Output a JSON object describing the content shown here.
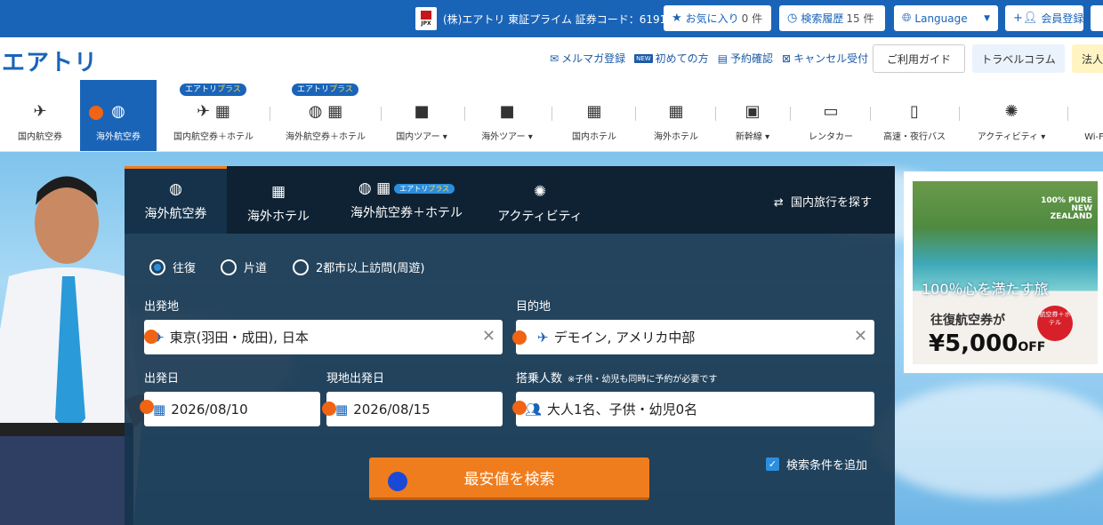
{
  "topbar": {
    "jpx_text": "JPX",
    "corp_info": "(株)エアトリ 東証プライム 証券コード：6191",
    "separator": "|",
    "favorites_label": "お気に入り",
    "favorites_count": "0 件",
    "history_label": "検索履歴",
    "history_count": "15 件",
    "language_label": "Language",
    "register_label": "会員登録"
  },
  "header": {
    "logo": "エアトリ",
    "links": [
      {
        "icon": "mail-icon",
        "label": "メルマガ登録"
      },
      {
        "icon": "new-icon",
        "label": "初めての方",
        "badge": "NEW"
      },
      {
        "icon": "document-icon",
        "label": "予約確認"
      },
      {
        "icon": "calendar-cancel-icon",
        "label": "キャンセル受付"
      }
    ],
    "guide_label": "ご利用ガイド",
    "column_label": "トラベルコラム",
    "corporate_label": "法人"
  },
  "categories": [
    {
      "label": "国内航空券",
      "active": false
    },
    {
      "label": "海外航空券",
      "active": true
    },
    {
      "label": "国内航空券＋ホテル",
      "active": false,
      "plus": true
    },
    {
      "label": "海外航空券＋ホテル",
      "active": false,
      "plus": true
    },
    {
      "label": "国内ツアー ▾",
      "active": false
    },
    {
      "label": "海外ツアー ▾",
      "active": false
    },
    {
      "label": "国内ホテル",
      "active": false
    },
    {
      "label": "海外ホテル",
      "active": false
    },
    {
      "label": "新幹線 ▾",
      "active": false
    },
    {
      "label": "レンタカー",
      "active": false
    },
    {
      "label": "高速・夜行バス",
      "active": false
    },
    {
      "label": "アクティビティ ▾",
      "active": false
    },
    {
      "label": "Wi-Fi",
      "active": false
    }
  ],
  "plus_badge": {
    "left": "エアトリ",
    "right": "プラス"
  },
  "search": {
    "tabs": [
      {
        "label": "海外航空券",
        "active": true
      },
      {
        "label": "海外ホテル",
        "active": false
      },
      {
        "label": "海外航空券＋ホテル",
        "active": false
      },
      {
        "label": "アクティビティ",
        "active": false
      }
    ],
    "switch_label": "国内旅行を探す",
    "trip_types": [
      {
        "label": "往復",
        "selected": true
      },
      {
        "label": "片道",
        "selected": false
      },
      {
        "label": "2都市以上訪問(周遊)",
        "selected": false
      }
    ],
    "origin_label": "出発地",
    "origin_value": "東京(羽田・成田), 日本",
    "destination_label": "目的地",
    "destination_value": "デモイン, アメリカ中部",
    "depart_label": "出発日",
    "depart_value": "2026/08/10",
    "return_label": "現地出発日",
    "return_value": "2026/08/15",
    "passengers_label": "搭乗人数",
    "passengers_note": "※子供・幼児も同時に予約が必要です",
    "passengers_value": "大人1名、子供・幼児0名",
    "search_button": "最安値を検索",
    "add_conditions": "検索条件を追加"
  },
  "ad": {
    "tag": "100% PURE NEW ZEALAND",
    "catch": "100％心を満たす旅",
    "round_trip": "往復航空券が",
    "seal": "航空券＋ホテル",
    "price": "¥5,000",
    "off": "OFF"
  },
  "colors": {
    "brand_blue": "#1a64b8",
    "accent_orange": "#f07d1d",
    "marker_orange": "#f06414",
    "marker_blue": "#1a49d8"
  }
}
